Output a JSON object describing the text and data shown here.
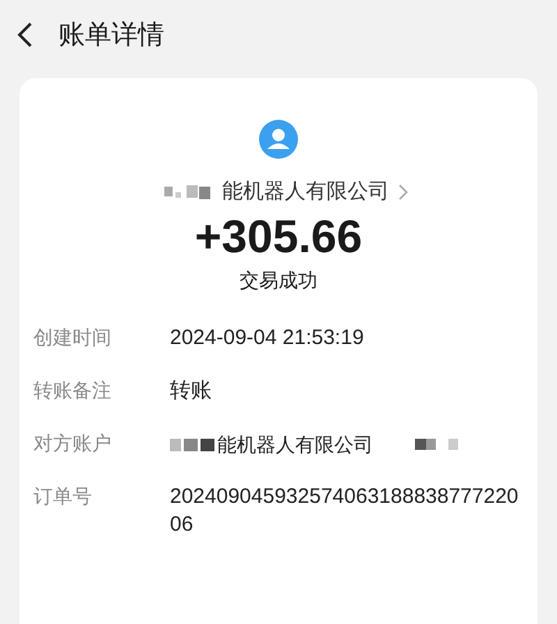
{
  "header": {
    "title": "账单详情"
  },
  "summary": {
    "payee": "能机器人有限公司",
    "amount": "+305.66",
    "status": "交易成功"
  },
  "details": [
    {
      "label": "创建时间",
      "value": "2024-09-04 21:53:19",
      "kind": "text"
    },
    {
      "label": "转账备注",
      "value": "转账",
      "kind": "text"
    },
    {
      "label": "对方账户",
      "value": "能机器人有限公司",
      "kind": "redacted"
    },
    {
      "label": "订单号",
      "value": "20240904593257406318883877722006",
      "kind": "text"
    }
  ]
}
